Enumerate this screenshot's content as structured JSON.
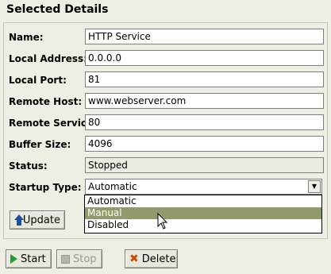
{
  "header": {
    "title": "Selected Details"
  },
  "fields": [
    {
      "label": "Name:",
      "value": "HTTP Service"
    },
    {
      "label": "Local Address:",
      "value": "0.0.0.0"
    },
    {
      "label": "Local Port:",
      "value": "81"
    },
    {
      "label": "Remote Host:",
      "value": "www.webserver.com"
    },
    {
      "label": "Remote Service:",
      "value": "80"
    },
    {
      "label": "Buffer Size:",
      "value": "4096"
    },
    {
      "label": "Status:",
      "value": "Stopped"
    }
  ],
  "startup": {
    "label": "Startup Type:",
    "selected": "Automatic",
    "options": [
      "Automatic",
      "Manual",
      "Disabled"
    ],
    "highlighted": "Manual"
  },
  "buttons": {
    "update": "Update",
    "start": "Start",
    "stop": "Stop",
    "delete": "Delete"
  },
  "colors": {
    "highlight": "#8f9b6b",
    "background": "#eeeee4",
    "start_icon": "#1c9c2c",
    "update_icon": "#1c4f9c",
    "delete_icon": "#d04a00"
  },
  "icons": {
    "update": "up-arrow-icon",
    "start": "play-icon",
    "stop": "stop-icon",
    "delete": "x-icon",
    "dropdown": "chevron-down-icon"
  }
}
